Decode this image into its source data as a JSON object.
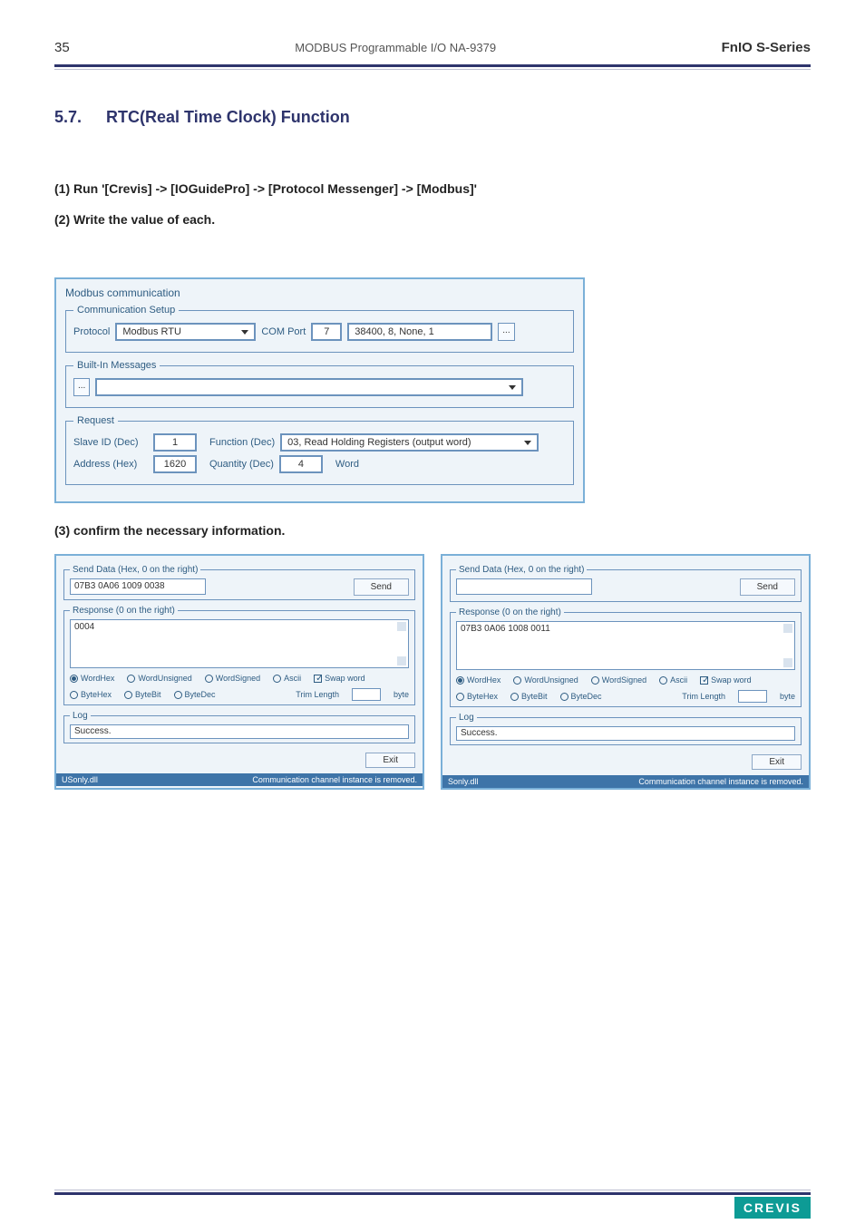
{
  "header": {
    "page_number": "35",
    "doc_title": "MODBUS Programmable I/O NA-9379",
    "series": "FnIO  S-Series"
  },
  "section": {
    "number": "5.7.",
    "title": "RTC(Real Time Clock) Function"
  },
  "steps": {
    "s1": "(1) Run '[Crevis] -> [IOGuidePro] -> [Protocol Messenger] -> [Modbus]'",
    "s2": "(2) Write the value of each.",
    "s3": "(3) confirm the necessary information."
  },
  "modbus_window": {
    "title": "Modbus communication",
    "group_comm": "Communication Setup",
    "protocol_label": "Protocol",
    "protocol_value": "Modbus RTU",
    "comport_label": "COM Port",
    "comport_value": "7",
    "comparams_value": "38400, 8, None, 1",
    "ellipsis": "...",
    "group_builtin": "Built-In Messages",
    "group_request": "Request",
    "slave_label": "Slave ID (Dec)",
    "slave_value": "1",
    "function_label": "Function (Dec)",
    "function_value": "03, Read Holding Registers (output word)",
    "address_label": "Address (Hex)",
    "address_value": "1620",
    "quantity_label": "Quantity (Dec)",
    "quantity_value": "4",
    "word": "Word"
  },
  "panelA": {
    "send_legend": "Send Data (Hex, 0 on the right)",
    "send_value": "07B3 0A06 1009 0038",
    "send_btn": "Send",
    "resp_legend": "Response (0 on the right)",
    "resp_value": "0004",
    "r_wordhex": "WordHex",
    "r_wordunsigned": "WordUnsigned",
    "r_wordsigned": "WordSigned",
    "r_ascii": "Ascii",
    "c_swap": "Swap word",
    "r_bytehex": "ByteHex",
    "r_bytebit": "ByteBit",
    "r_bytedec": "ByteDec",
    "trim_label": "Trim Length",
    "trim_unit": "byte",
    "log_legend": "Log",
    "log_value": "Success.",
    "exit_btn": "Exit",
    "status_left": "USonly.dll",
    "status_right": "Communication channel instance is removed."
  },
  "panelB": {
    "send_legend": "Send Data (Hex, 0 on the right)",
    "send_value": "",
    "send_btn": "Send",
    "resp_legend": "Response (0 on the right)",
    "resp_value": "07B3 0A06 1008 0011",
    "r_wordhex": "WordHex",
    "r_wordunsigned": "WordUnsigned",
    "r_wordsigned": "WordSigned",
    "r_ascii": "Ascii",
    "c_swap": "Swap word",
    "r_bytehex": "ByteHex",
    "r_bytebit": "ByteBit",
    "r_bytedec": "ByteDec",
    "trim_label": "Trim Length",
    "trim_unit": "byte",
    "log_legend": "Log",
    "log_value": "Success.",
    "exit_btn": "Exit",
    "status_left": "Sonly.dll",
    "status_right": "Communication channel instance is removed."
  },
  "footer": {
    "brand": "CREVIS"
  }
}
